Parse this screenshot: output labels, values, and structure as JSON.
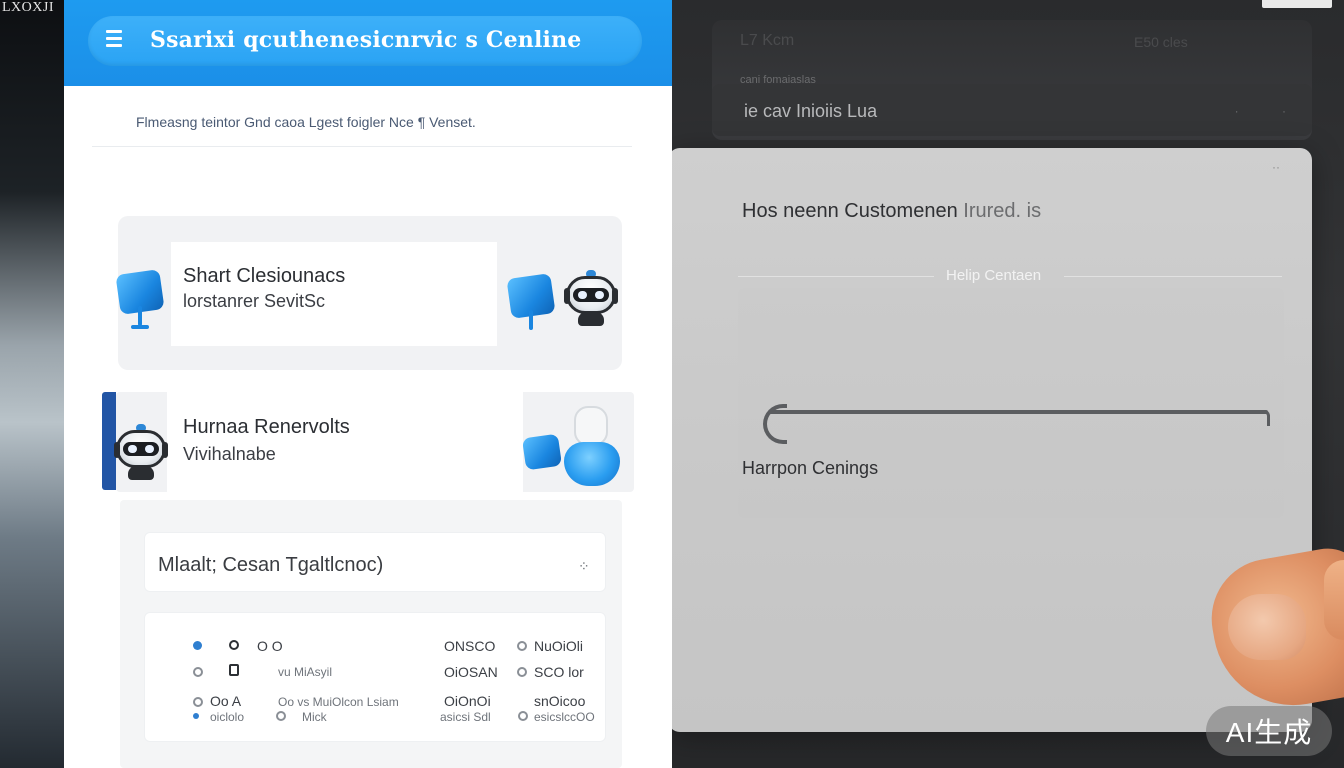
{
  "background": {
    "corner_text": "LXOXJI",
    "back_card": {
      "row1_left": "L7 Kcm",
      "row1_right": "E50 cles",
      "label": "cani fomaiaslas",
      "pill_text": "ie cav Inioiis Lua",
      "pill_dots": "· ·"
    }
  },
  "header": {
    "title": "Ssarixi qcuthenesicnrvic s Cenline"
  },
  "subheader": {
    "text": "Flmeasng teintor Gnd caoa Lgest foigler Nce ¶ Venset."
  },
  "cards": [
    {
      "title": "Shart Clesiounacs",
      "subtitle": "lorstanrer SevitSc"
    },
    {
      "title": "Hurnaa Renervolts",
      "subtitle": "Vivihalnabe"
    }
  ],
  "select": {
    "label": "Mlaalt; Cesan Tgaltlcnoc)",
    "icon": "move-icon"
  },
  "table": {
    "rows": [
      {
        "col_a": "O O",
        "col_b": "",
        "col_c": "ONSCO",
        "col_d": "NuOiOli"
      },
      {
        "col_a": "",
        "col_b": "vu MiAsyil",
        "col_c": "OiOSAN",
        "col_d": "SCO lor"
      },
      {
        "col_a": "Oo A",
        "col_b": "Oo vs MuiOlcon Lsiam",
        "col_c": "OiOnOi",
        "col_d": "snOicoo"
      },
      {
        "col_a": "oiclolo",
        "col_b": "Mick",
        "col_c": "asicsi Sdl",
        "col_d": "esicslccOO"
      }
    ]
  },
  "overlay": {
    "close": "··",
    "title": "Hos neenn Customenen",
    "title_suffix": "Irured. is",
    "divider_label": "Helip Centaen",
    "subtitle": "Harrpon Cenings"
  },
  "watermark": "AI生成",
  "colors": {
    "header_blue": "#1e9bf0",
    "accent_blue": "#2a9df0",
    "overlay_gray": "#cbcbcb"
  }
}
